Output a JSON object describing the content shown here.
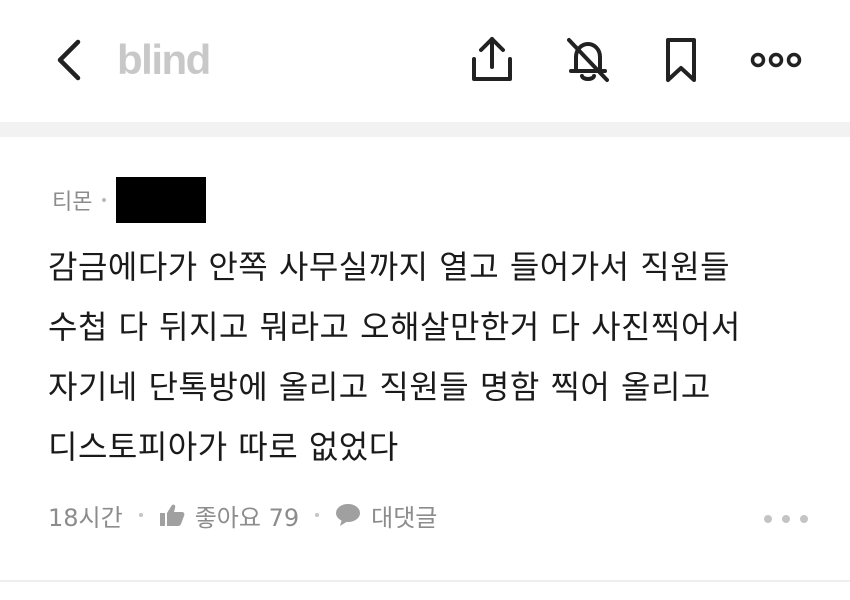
{
  "header": {
    "logo_text": "blind",
    "icons": [
      "back-icon",
      "share-icon",
      "bell-off-icon",
      "bookmark-icon",
      "more-horizontal-icon"
    ]
  },
  "comment": {
    "company": "티몬",
    "body_lines": [
      "감금에다가 안쪽 사무실까지 열고 들어가서 직원들",
      "수첩 다 뒤지고 뭐라고 오해살만한거 다 사진찍어서",
      "자기네 단톡방에 올리고 직원들 명함 찍어 올리고",
      "디스토피아가 따로 없었다"
    ],
    "time": "18시간",
    "like_label": "좋아요 79",
    "reply_label": "대댓글"
  },
  "colors": {
    "logo": "#c8c8c8",
    "text_primary": "#1a1a1a",
    "text_secondary": "#8c8c8c",
    "icon_dark": "#222222",
    "redaction": "#000000"
  }
}
